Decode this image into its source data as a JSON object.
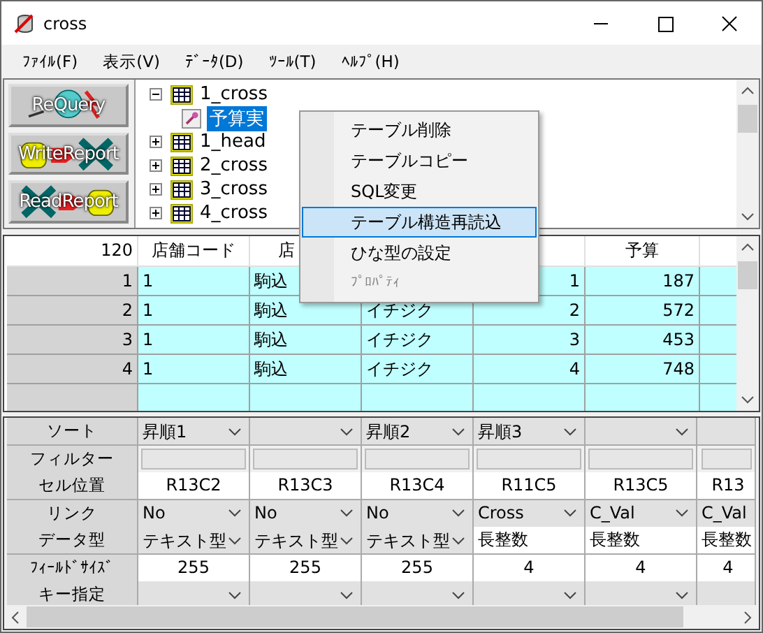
{
  "window": {
    "title": "cross"
  },
  "menu": [
    "ﾌｧｲﾙ(F)",
    "表示(V)",
    "ﾃﾞｰﾀ(D)",
    "ﾂｰﾙ(T)",
    "ﾍﾙﾌﾟ(H)"
  ],
  "toolbar": [
    {
      "label": "ReQuery",
      "kind": "requery"
    },
    {
      "label": "WriteReport",
      "kind": "write"
    },
    {
      "label": "ReadReport",
      "kind": "read"
    }
  ],
  "tree": [
    {
      "label": "1_cross",
      "expanded": true,
      "selected": false,
      "children": [
        {
          "label": "予算実",
          "selected": true
        }
      ]
    },
    {
      "label": "1_head",
      "expanded": false,
      "selected": false
    },
    {
      "label": "2_cross",
      "expanded": false,
      "selected": false
    },
    {
      "label": "3_cross",
      "expanded": false,
      "selected": false
    },
    {
      "label": "4_cross",
      "expanded": false,
      "selected": false
    }
  ],
  "context_menu": [
    {
      "label": "テーブル削除",
      "selected": false,
      "disabled": false
    },
    {
      "label": "テーブルコピー",
      "selected": false,
      "disabled": false
    },
    {
      "label": "SQL変更",
      "selected": false,
      "disabled": false
    },
    {
      "label": "テーブル構造再読込",
      "selected": true,
      "disabled": false
    },
    {
      "label": "ひな型の設定",
      "selected": false,
      "disabled": false
    },
    {
      "label": "ﾌﾟﾛﾊﾟﾃｨ",
      "selected": false,
      "disabled": true
    }
  ],
  "grid": {
    "corner": "120",
    "columns": [
      "店舗コード",
      "店",
      null,
      null,
      "予算",
      null
    ],
    "rows": [
      {
        "number": "1",
        "cells": [
          "1",
          "駒込",
          null,
          "1",
          "187",
          null
        ]
      },
      {
        "number": "2",
        "cells": [
          "1",
          "駒込",
          "イチジク",
          "2",
          "572",
          null
        ]
      },
      {
        "number": "3",
        "cells": [
          "1",
          "駒込",
          "イチジク",
          "3",
          "453",
          null
        ]
      },
      {
        "number": "4",
        "cells": [
          "1",
          "駒込",
          "イチジク",
          "4",
          "748",
          null
        ]
      }
    ]
  },
  "properties": [
    {
      "label": "ソート",
      "cells": [
        {
          "kind": "combo",
          "value": "昇順1"
        },
        {
          "kind": "combo"
        },
        {
          "kind": "combo",
          "value": "昇順2"
        },
        {
          "kind": "combo",
          "value": "昇順3"
        },
        {
          "kind": "combo"
        },
        {
          "kind": "combo"
        }
      ]
    },
    {
      "label": "フィルター",
      "cells": [
        {
          "kind": "field"
        },
        {
          "kind": "field"
        },
        {
          "kind": "field"
        },
        {
          "kind": "field"
        },
        {
          "kind": "field"
        },
        {
          "kind": "field"
        }
      ]
    },
    {
      "label": "セル位置",
      "cells": [
        {
          "kind": "center",
          "value": "R13C2"
        },
        {
          "kind": "center",
          "value": "R13C3"
        },
        {
          "kind": "center",
          "value": "R13C4"
        },
        {
          "kind": "center",
          "value": "R11C5"
        },
        {
          "kind": "center",
          "value": "R13C5"
        },
        {
          "kind": "center",
          "value": "R13"
        }
      ]
    },
    {
      "label": "リンク",
      "cells": [
        {
          "kind": "combo",
          "value": "No"
        },
        {
          "kind": "combo",
          "value": "No"
        },
        {
          "kind": "combo",
          "value": "No"
        },
        {
          "kind": "combo",
          "value": "Cross"
        },
        {
          "kind": "combo",
          "value": "C_Val"
        },
        {
          "kind": "combo",
          "value": "C_Val"
        }
      ]
    },
    {
      "label": "データ型",
      "cells": [
        {
          "kind": "combo",
          "value": "テキスト型"
        },
        {
          "kind": "combo",
          "value": "テキスト型"
        },
        {
          "kind": "combo",
          "value": "テキスト型"
        },
        {
          "kind": "text",
          "value": "長整数"
        },
        {
          "kind": "text",
          "value": "長整数"
        },
        {
          "kind": "text",
          "value": "長整数"
        }
      ]
    },
    {
      "label": "ﾌｨｰﾙﾄﾞｻｲｽﾞ",
      "cells": [
        {
          "kind": "center",
          "value": "255"
        },
        {
          "kind": "center",
          "value": "255"
        },
        {
          "kind": "center",
          "value": "255"
        },
        {
          "kind": "center",
          "value": "4"
        },
        {
          "kind": "center",
          "value": "4"
        },
        {
          "kind": "center",
          "value": "4"
        }
      ]
    },
    {
      "label": "キー指定",
      "cells": [
        {
          "kind": "combo"
        },
        {
          "kind": "combo"
        },
        {
          "kind": "combo"
        },
        {
          "kind": "combo"
        },
        {
          "kind": "combo"
        },
        {
          "kind": "combo"
        }
      ]
    }
  ]
}
